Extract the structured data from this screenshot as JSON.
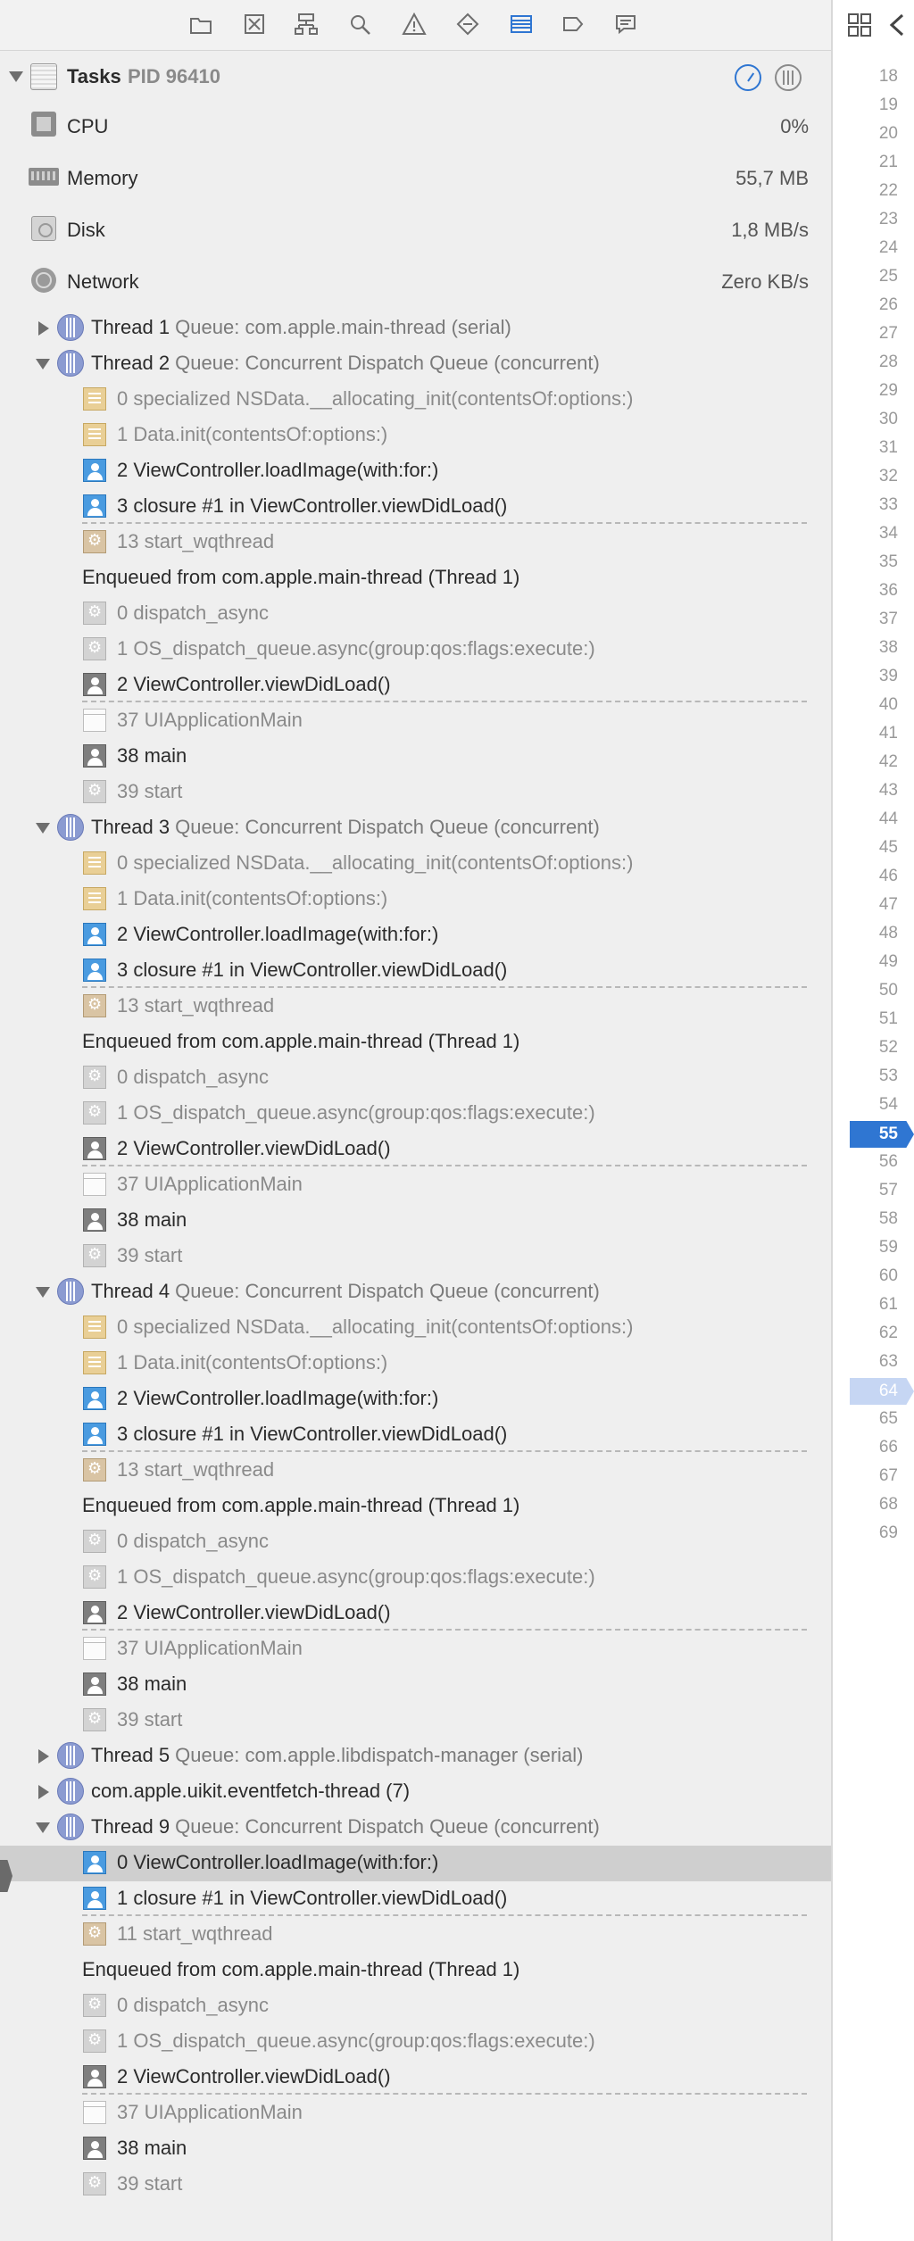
{
  "toolbar": {
    "icons": [
      "folder-icon",
      "source-control-icon",
      "hierarchy-icon",
      "search-icon",
      "warning-icon",
      "test-icon",
      "debug-navigator-icon",
      "breakpoint-icon",
      "report-icon"
    ],
    "active_icon": "debug-navigator-icon",
    "accent": "#2f76d2"
  },
  "process": {
    "name": "Tasks",
    "pid_label": "PID 96410"
  },
  "summary": [
    {
      "label": "CPU",
      "value": "0%"
    },
    {
      "label": "Memory",
      "value": "55,7 MB"
    },
    {
      "label": "Disk",
      "value": "1,8 MB/s"
    },
    {
      "label": "Network",
      "value": "Zero KB/s"
    }
  ],
  "rows": [
    {
      "kind": "thread",
      "expanded": false,
      "name": "Thread 1",
      "queue": "Queue: com.apple.main-thread (serial)"
    },
    {
      "kind": "thread",
      "expanded": true,
      "name": "Thread 2",
      "queue": "Queue: Concurrent Dispatch Queue (concurrent)"
    },
    {
      "kind": "frame",
      "icon": "lib",
      "text": "0 specialized NSData.__allocating_init(contentsOf:options:)",
      "dim": true
    },
    {
      "kind": "frame",
      "icon": "lib",
      "text": "1 Data.init(contentsOf:options:)",
      "dim": true
    },
    {
      "kind": "frame",
      "icon": "user",
      "text": "2 ViewController.loadImage(with:for:)"
    },
    {
      "kind": "frame",
      "icon": "user",
      "text": "3 closure #1 in ViewController.viewDidLoad()"
    },
    {
      "kind": "frame",
      "icon": "syswq",
      "text": "13 start_wqthread",
      "dim": true,
      "dashed_above": true
    },
    {
      "kind": "enqueued",
      "text": "Enqueued from com.apple.main-thread (Thread 1)"
    },
    {
      "kind": "frame",
      "icon": "sys",
      "text": "0 dispatch_async",
      "dim": true
    },
    {
      "kind": "frame",
      "icon": "sys",
      "text": "1 OS_dispatch_queue.async(group:qos:flags:execute:)",
      "dim": true
    },
    {
      "kind": "frame",
      "icon": "userg",
      "text": "2 ViewController.viewDidLoad()"
    },
    {
      "kind": "frame",
      "icon": "win",
      "text": "37 UIApplicationMain",
      "dim": true,
      "dashed_above": true
    },
    {
      "kind": "frame",
      "icon": "userg",
      "text": "38 main"
    },
    {
      "kind": "frame",
      "icon": "sys",
      "text": "39 start",
      "dim": true
    },
    {
      "kind": "thread",
      "expanded": true,
      "name": "Thread 3",
      "queue": "Queue: Concurrent Dispatch Queue (concurrent)"
    },
    {
      "kind": "frame",
      "icon": "lib",
      "text": "0 specialized NSData.__allocating_init(contentsOf:options:)",
      "dim": true
    },
    {
      "kind": "frame",
      "icon": "lib",
      "text": "1 Data.init(contentsOf:options:)",
      "dim": true
    },
    {
      "kind": "frame",
      "icon": "user",
      "text": "2 ViewController.loadImage(with:for:)"
    },
    {
      "kind": "frame",
      "icon": "user",
      "text": "3 closure #1 in ViewController.viewDidLoad()"
    },
    {
      "kind": "frame",
      "icon": "syswq",
      "text": "13 start_wqthread",
      "dim": true,
      "dashed_above": true
    },
    {
      "kind": "enqueued",
      "text": "Enqueued from com.apple.main-thread (Thread 1)"
    },
    {
      "kind": "frame",
      "icon": "sys",
      "text": "0 dispatch_async",
      "dim": true
    },
    {
      "kind": "frame",
      "icon": "sys",
      "text": "1 OS_dispatch_queue.async(group:qos:flags:execute:)",
      "dim": true
    },
    {
      "kind": "frame",
      "icon": "userg",
      "text": "2 ViewController.viewDidLoad()"
    },
    {
      "kind": "frame",
      "icon": "win",
      "text": "37 UIApplicationMain",
      "dim": true,
      "dashed_above": true
    },
    {
      "kind": "frame",
      "icon": "userg",
      "text": "38 main"
    },
    {
      "kind": "frame",
      "icon": "sys",
      "text": "39 start",
      "dim": true
    },
    {
      "kind": "thread",
      "expanded": true,
      "name": "Thread 4",
      "queue": "Queue: Concurrent Dispatch Queue (concurrent)"
    },
    {
      "kind": "frame",
      "icon": "lib",
      "text": "0 specialized NSData.__allocating_init(contentsOf:options:)",
      "dim": true
    },
    {
      "kind": "frame",
      "icon": "lib",
      "text": "1 Data.init(contentsOf:options:)",
      "dim": true
    },
    {
      "kind": "frame",
      "icon": "user",
      "text": "2 ViewController.loadImage(with:for:)"
    },
    {
      "kind": "frame",
      "icon": "user",
      "text": "3 closure #1 in ViewController.viewDidLoad()"
    },
    {
      "kind": "frame",
      "icon": "syswq",
      "text": "13 start_wqthread",
      "dim": true,
      "dashed_above": true
    },
    {
      "kind": "enqueued",
      "text": "Enqueued from com.apple.main-thread (Thread 1)"
    },
    {
      "kind": "frame",
      "icon": "sys",
      "text": "0 dispatch_async",
      "dim": true
    },
    {
      "kind": "frame",
      "icon": "sys",
      "text": "1 OS_dispatch_queue.async(group:qos:flags:execute:)",
      "dim": true
    },
    {
      "kind": "frame",
      "icon": "userg",
      "text": "2 ViewController.viewDidLoad()"
    },
    {
      "kind": "frame",
      "icon": "win",
      "text": "37 UIApplicationMain",
      "dim": true,
      "dashed_above": true
    },
    {
      "kind": "frame",
      "icon": "userg",
      "text": "38 main"
    },
    {
      "kind": "frame",
      "icon": "sys",
      "text": "39 start",
      "dim": true
    },
    {
      "kind": "thread",
      "expanded": false,
      "name": "Thread 5",
      "queue": "Queue: com.apple.libdispatch-manager (serial)"
    },
    {
      "kind": "thread",
      "expanded": false,
      "name": "com.apple.uikit.eventfetch-thread (7)",
      "queue": ""
    },
    {
      "kind": "thread",
      "expanded": true,
      "name": "Thread 9",
      "queue": "Queue: Concurrent Dispatch Queue (concurrent)"
    },
    {
      "kind": "frame",
      "icon": "user",
      "text": "0 ViewController.loadImage(with:for:)",
      "selected": true
    },
    {
      "kind": "frame",
      "icon": "user",
      "text": "1 closure #1 in ViewController.viewDidLoad()"
    },
    {
      "kind": "frame",
      "icon": "syswq",
      "text": "11 start_wqthread",
      "dim": true,
      "dashed_above": true
    },
    {
      "kind": "enqueued",
      "text": "Enqueued from com.apple.main-thread (Thread 1)"
    },
    {
      "kind": "frame",
      "icon": "sys",
      "text": "0 dispatch_async",
      "dim": true
    },
    {
      "kind": "frame",
      "icon": "sys",
      "text": "1 OS_dispatch_queue.async(group:qos:flags:execute:)",
      "dim": true
    },
    {
      "kind": "frame",
      "icon": "userg",
      "text": "2 ViewController.viewDidLoad()"
    },
    {
      "kind": "frame",
      "icon": "win",
      "text": "37 UIApplicationMain",
      "dim": true,
      "dashed_above": true
    },
    {
      "kind": "frame",
      "icon": "userg",
      "text": "38 main"
    },
    {
      "kind": "frame",
      "icon": "sys",
      "text": "39 start",
      "dim": true
    }
  ],
  "gutter": {
    "lines": [
      "18",
      "19",
      "20",
      "21",
      "22",
      "23",
      "24",
      "25",
      "26",
      "27",
      "28",
      "29",
      "30",
      "31",
      "32",
      "33",
      "34",
      "35",
      "36",
      "37",
      "38",
      "39",
      "40",
      "41",
      "42",
      "43",
      "44",
      "45",
      "46",
      "47",
      "48",
      "49",
      "50",
      "51",
      "52",
      "53",
      "54",
      "55",
      "56",
      "57",
      "58",
      "59",
      "60",
      "61",
      "62",
      "63",
      "64",
      "65",
      "66",
      "67",
      "68",
      "69"
    ],
    "current_line": "55",
    "breakpoint_line": "64"
  }
}
